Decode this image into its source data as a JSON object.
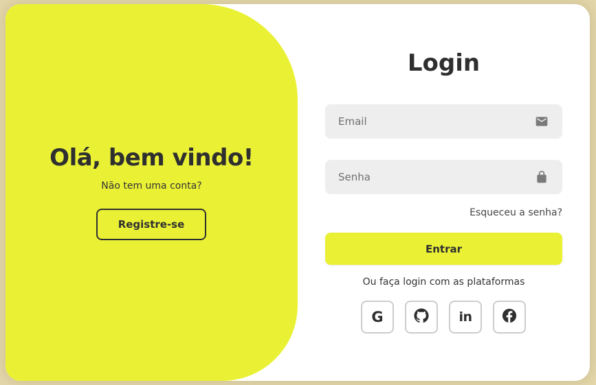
{
  "welcome": {
    "title": "Olá, bem vindo!",
    "subtitle": "Não tem uma conta?",
    "register_label": "Registre-se"
  },
  "login": {
    "title": "Login",
    "email_placeholder": "Email",
    "password_placeholder": "Senha",
    "forgot_label": "Esqueceu a senha?",
    "submit_label": "Entrar",
    "alt_text": "Ou faça login com as plataformas"
  },
  "social": {
    "google_glyph": "G",
    "linkedin_glyph": "in",
    "icons": [
      "google-icon",
      "github-icon",
      "linkedin-icon",
      "facebook-icon"
    ]
  },
  "colors": {
    "accent": "#eaf135",
    "text": "#2f2f2f",
    "field_bg": "#eeeeee",
    "page_bg": "#e3d6a8"
  }
}
